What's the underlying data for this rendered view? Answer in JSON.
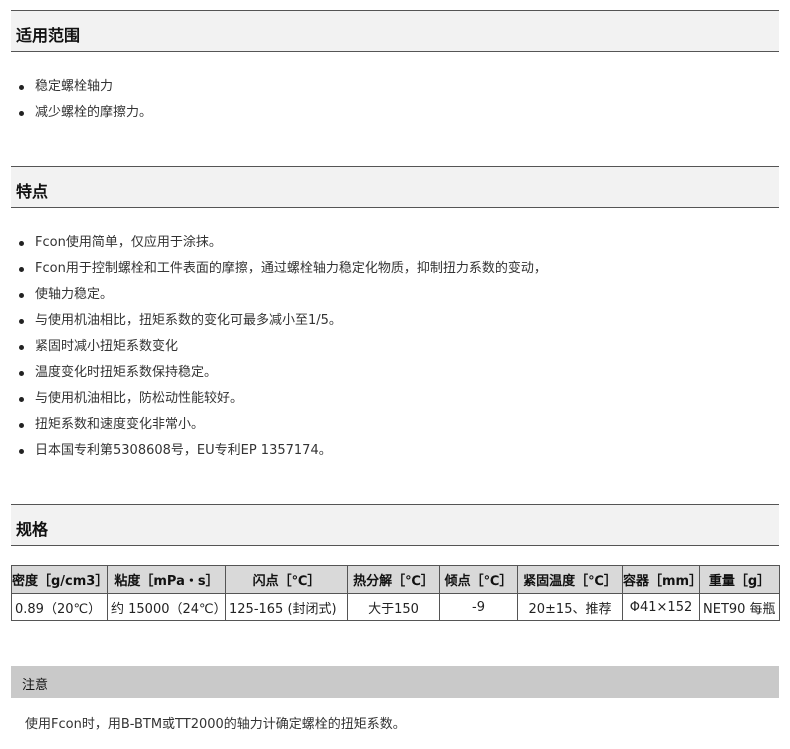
{
  "scope": {
    "title": "适用范围",
    "items": [
      "稳定螺栓轴力",
      "减少螺栓的摩擦力。"
    ]
  },
  "features": {
    "title": "特点",
    "items": [
      "Fcon使用简单，仅应用于涂抹。",
      "Fcon用于控制螺栓和工件表面的摩擦，通过螺栓轴力稳定化物质，抑制扭力系数的变动，",
      "使轴力稳定。",
      "与使用机油相比，扭矩系数的变化可最多减小至1/5。",
      "紧固时减小扭矩系数变化",
      "温度变化时扭矩系数保持稳定。",
      "与使用机油相比，防松动性能较好。",
      "扭矩系数和速度变化非常小。",
      "日本国专利第5308608号，EU专利EP 1357174。"
    ]
  },
  "specs": {
    "title": "规格",
    "headers": [
      "密度［g/cm3］",
      "粘度［mPa・s］",
      "闪点［℃］",
      "热分解［℃］",
      "倾点［℃］",
      "紧固温度［℃］",
      "容器［mm］",
      "重量［g］"
    ],
    "row": [
      "0.89（20℃）",
      "约 15000（24℃）",
      "125-165 (封闭式)",
      "大于150",
      "-9",
      "20±15、推荐",
      "Φ41×152",
      "NET90 每瓶"
    ]
  },
  "note": {
    "title": "注意",
    "text": "使用Fcon时，用B-BTM或TT2000的轴力计确定螺栓的扭矩系数。"
  }
}
